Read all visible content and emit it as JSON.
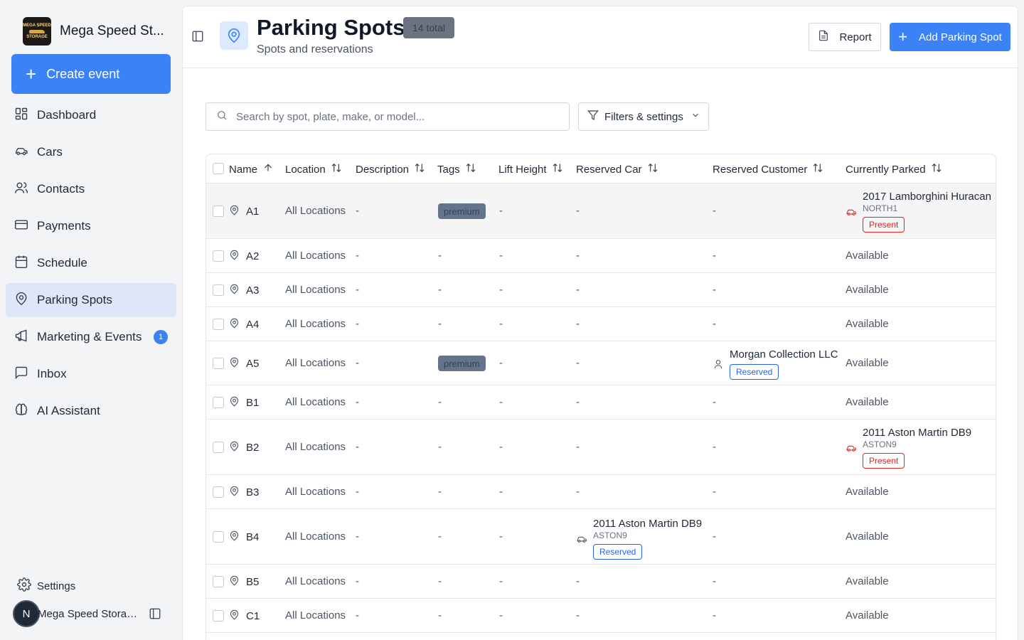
{
  "brand": {
    "name": "Mega Speed St...",
    "logo_text_top": "MEGA SPEED",
    "logo_text_bottom": "STORAGE"
  },
  "sidebar": {
    "create_label": "Create event",
    "items": [
      {
        "label": "Dashboard",
        "icon": "dashboard-icon"
      },
      {
        "label": "Cars",
        "icon": "car-icon"
      },
      {
        "label": "Contacts",
        "icon": "contacts-icon"
      },
      {
        "label": "Payments",
        "icon": "credit-card-icon"
      },
      {
        "label": "Schedule",
        "icon": "calendar-icon"
      },
      {
        "label": "Parking Spots",
        "icon": "map-pin-icon",
        "active": true
      },
      {
        "label": "Marketing & Events",
        "icon": "megaphone-icon",
        "badge": "1"
      },
      {
        "label": "Inbox",
        "icon": "inbox-icon"
      },
      {
        "label": "AI Assistant",
        "icon": "brain-icon"
      }
    ],
    "settings_label": "Settings",
    "user_initial": "N",
    "user_name": "Mega Speed Storag..."
  },
  "header": {
    "title": "Parking Spots",
    "count_badge": "14 total",
    "subtitle": "Spots and reservations",
    "report_label": "Report",
    "add_label": "Add Parking Spot"
  },
  "search": {
    "placeholder": "Search by spot, plate, make, or model..."
  },
  "filters_label": "Filters & settings",
  "table": {
    "columns": [
      "Name",
      "Location",
      "Description",
      "Tags",
      "Lift Height",
      "Reserved Car",
      "Reserved Customer",
      "Currently Parked"
    ],
    "rows": [
      {
        "name": "A1",
        "location": "All Locations",
        "description": "-",
        "tag": "premium",
        "lift": "-",
        "reserved_car": "-",
        "reserved_customer": "-",
        "parked": {
          "title": "2017 Lamborghini Huracan",
          "sub": "NORTH1",
          "status": "Present"
        }
      },
      {
        "name": "A2",
        "location": "All Locations",
        "description": "-",
        "tag": "-",
        "lift": "-",
        "reserved_car": "-",
        "reserved_customer": "-",
        "parked_text": "Available"
      },
      {
        "name": "A3",
        "location": "All Locations",
        "description": "-",
        "tag": "-",
        "lift": "-",
        "reserved_car": "-",
        "reserved_customer": "-",
        "parked_text": "Available"
      },
      {
        "name": "A4",
        "location": "All Locations",
        "description": "-",
        "tag": "-",
        "lift": "-",
        "reserved_car": "-",
        "reserved_customer": "-",
        "parked_text": "Available"
      },
      {
        "name": "A5",
        "location": "All Locations",
        "description": "-",
        "tag": "premium",
        "lift": "-",
        "reserved_car": "-",
        "customer": {
          "title": "Morgan Collection LLC",
          "status": "Reserved"
        },
        "parked_text": "Available"
      },
      {
        "name": "B1",
        "location": "All Locations",
        "description": "-",
        "tag": "-",
        "lift": "-",
        "reserved_car": "-",
        "reserved_customer": "-",
        "parked_text": "Available"
      },
      {
        "name": "B2",
        "location": "All Locations",
        "description": "-",
        "tag": "-",
        "lift": "-",
        "reserved_car": "-",
        "reserved_customer": "-",
        "parked": {
          "title": "2011 Aston Martin DB9",
          "sub": "ASTON9",
          "status": "Present"
        }
      },
      {
        "name": "B3",
        "location": "All Locations",
        "description": "-",
        "tag": "-",
        "lift": "-",
        "reserved_car": "-",
        "reserved_customer": "-",
        "parked_text": "Available"
      },
      {
        "name": "B4",
        "location": "All Locations",
        "description": "-",
        "tag": "-",
        "lift": "-",
        "car": {
          "title": "2011 Aston Martin DB9",
          "sub": "ASTON9",
          "status": "Reserved"
        },
        "reserved_customer": "-",
        "parked_text": "Available"
      },
      {
        "name": "B5",
        "location": "All Locations",
        "description": "-",
        "tag": "-",
        "lift": "-",
        "reserved_car": "-",
        "reserved_customer": "-",
        "parked_text": "Available"
      },
      {
        "name": "C1",
        "location": "All Locations",
        "description": "-",
        "tag": "-",
        "lift": "-",
        "reserved_car": "-",
        "reserved_customer": "-",
        "parked_text": "Available"
      }
    ]
  },
  "colors": {
    "accent": "#3b82f6",
    "present": "#dc2626",
    "reserved": "#2563eb",
    "tag": "#64748b"
  }
}
